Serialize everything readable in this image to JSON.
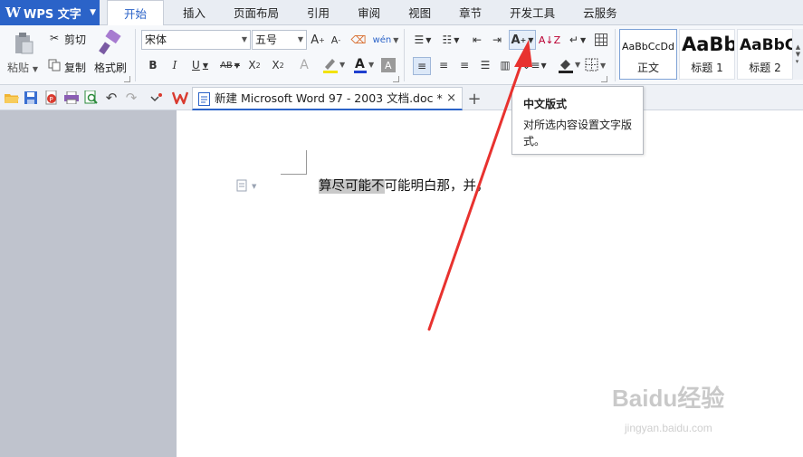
{
  "app": {
    "title": "WPS 文字"
  },
  "tabs": [
    "开始",
    "插入",
    "页面布局",
    "引用",
    "审阅",
    "视图",
    "章节",
    "开发工具",
    "云服务"
  ],
  "clipboard": {
    "paste": "粘贴",
    "cut": "剪切",
    "copy": "复制",
    "format_painter": "格式刷"
  },
  "font": {
    "name": "宋体",
    "size": "五号"
  },
  "styles": [
    {
      "sample": "AaBbCcDd",
      "name": "正文"
    },
    {
      "sample": "AaBb",
      "name": "标题 1"
    },
    {
      "sample": "AaBbC",
      "name": "标题 2"
    }
  ],
  "document_tab": {
    "title": "新建 Microsoft Word 97 - 2003 文档.doc *",
    "close": "×",
    "new_tab": "+"
  },
  "tooltip": {
    "title": "中文版式",
    "description": "对所选内容设置文字版式。"
  },
  "document": {
    "highlighted_text": "算尽可能不",
    "rest_text": "可能明白那，并，"
  },
  "watermark": {
    "brand": "Baidu经验",
    "url": "jingyan.baidu.com"
  },
  "colors": {
    "accent": "#2b63c8",
    "arrow": "#e8322f",
    "font_color_bar": "#1f3fcf",
    "highlight_bar": "#f2e200"
  }
}
